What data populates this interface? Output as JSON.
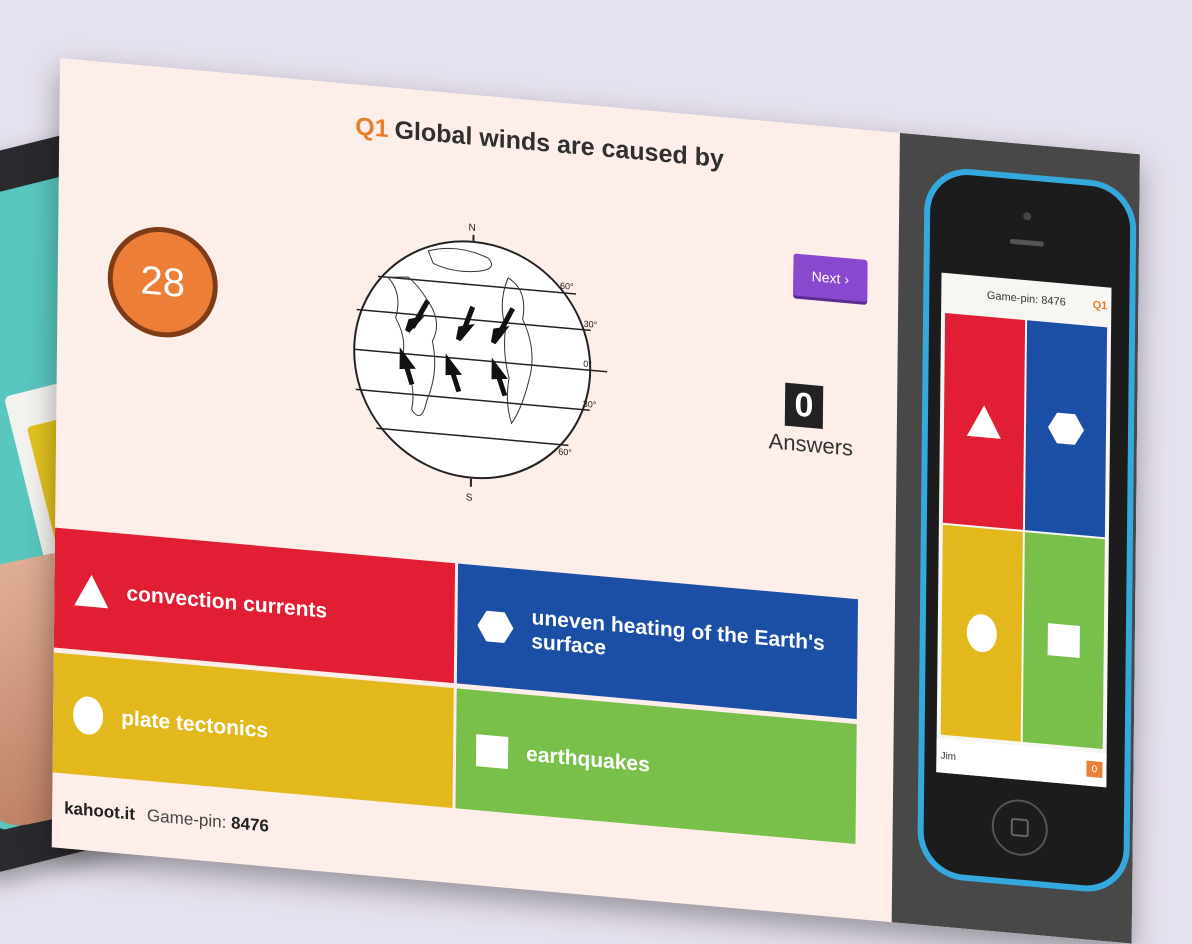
{
  "question": {
    "number": "Q1",
    "text": "Global winds are caused by"
  },
  "timer": "28",
  "next_button": "Next ›",
  "answers_count": {
    "value": "0",
    "label": "Answers"
  },
  "globe": {
    "north": "N",
    "south": "S",
    "lat_60n": "60°",
    "lat_30n": "30°",
    "lat_0": "0°",
    "lat_30s": "30°",
    "lat_60s": "60°"
  },
  "tiles": [
    {
      "label": "convection currents",
      "color": "#e11e34",
      "shape": "triangle-icon"
    },
    {
      "label": "uneven heating of the Earth's surface",
      "color": "#1b4fa6",
      "shape": "hexagon-icon"
    },
    {
      "label": "plate tectonics",
      "color": "#e2b81d",
      "shape": "circle-icon"
    },
    {
      "label": "earthquakes",
      "color": "#78c04a",
      "shape": "square-icon"
    }
  ],
  "footer": {
    "site": "kahoot.it",
    "pin_label": "Game-pin:",
    "pin_value": "8476"
  },
  "phone": {
    "pin": "Game-pin: 8476",
    "question": "Q1",
    "user": "Jim",
    "score": "0"
  }
}
